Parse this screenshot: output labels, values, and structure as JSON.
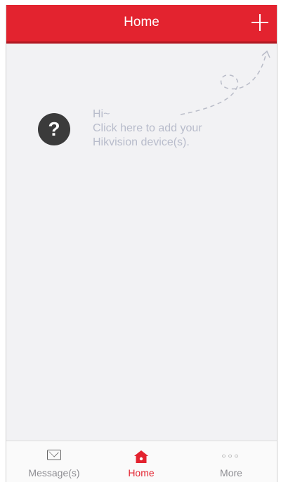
{
  "header": {
    "title": "Home"
  },
  "hint": {
    "greeting": "Hi~",
    "line1": "Click here to add your",
    "line2": "Hikvision device(s)."
  },
  "tabbar": {
    "messages_label": "Message(s)",
    "home_label": "Home",
    "more_label": "More"
  },
  "colors": {
    "accent": "#e3232f",
    "background": "#f2f2f4",
    "hint_text": "#b8bccb"
  },
  "icons": [
    "add-icon",
    "help-icon",
    "message-icon",
    "home-icon",
    "more-icon"
  ]
}
